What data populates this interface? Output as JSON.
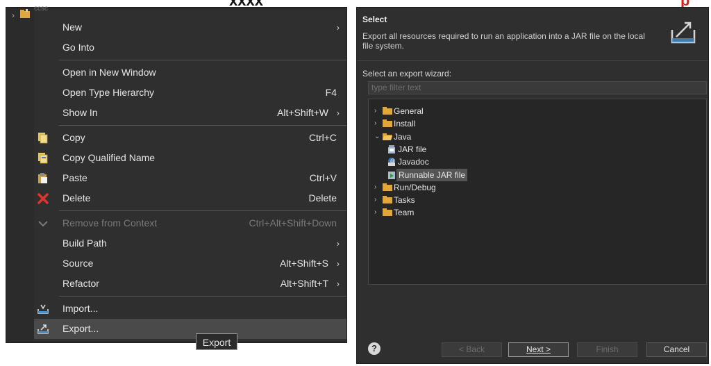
{
  "menu": {
    "project_label": "ccsc",
    "items": [
      {
        "label": "New",
        "accel": "",
        "submenu": true,
        "icon": ""
      },
      {
        "label": "Go Into",
        "accel": "",
        "submenu": false,
        "icon": ""
      },
      {
        "sep": true
      },
      {
        "label": "Open in New Window",
        "accel": "",
        "submenu": false,
        "icon": ""
      },
      {
        "label": "Open Type Hierarchy",
        "accel": "F4",
        "submenu": false,
        "icon": ""
      },
      {
        "label": "Show In",
        "accel": "Alt+Shift+W",
        "submenu": true,
        "icon": ""
      },
      {
        "sep": true
      },
      {
        "label": "Copy",
        "accel": "Ctrl+C",
        "submenu": false,
        "icon": "copy-icon"
      },
      {
        "label": "Copy Qualified Name",
        "accel": "",
        "submenu": false,
        "icon": "copy-qualified-icon"
      },
      {
        "label": "Paste",
        "accel": "Ctrl+V",
        "submenu": false,
        "icon": "paste-icon"
      },
      {
        "label": "Delete",
        "accel": "Delete",
        "submenu": false,
        "icon": "delete-icon"
      },
      {
        "sep": true
      },
      {
        "label": "Remove from Context",
        "accel": "Ctrl+Alt+Shift+Down",
        "submenu": false,
        "icon": "remove-context-icon",
        "disabled": true
      },
      {
        "label": "Build Path",
        "accel": "",
        "submenu": true,
        "icon": ""
      },
      {
        "label": "Source",
        "accel": "Alt+Shift+S",
        "submenu": true,
        "icon": ""
      },
      {
        "label": "Refactor",
        "accel": "Alt+Shift+T",
        "submenu": true,
        "icon": ""
      },
      {
        "sep": true
      },
      {
        "label": "Import...",
        "accel": "",
        "submenu": false,
        "icon": "import-icon"
      },
      {
        "label": "Export...",
        "accel": "",
        "submenu": false,
        "icon": "export-icon",
        "hover": true
      }
    ],
    "tooltip": "Export"
  },
  "wizard": {
    "title": "Select",
    "description": "Export all resources required to run an application into a JAR file on the local file system.",
    "select_label": "Select an export wizard:",
    "filter_placeholder": "type filter text",
    "tree": [
      {
        "label": "General",
        "level": 0,
        "expanded": false,
        "icon": "folder-icon"
      },
      {
        "label": "Install",
        "level": 0,
        "expanded": false,
        "icon": "folder-icon"
      },
      {
        "label": "Java",
        "level": 0,
        "expanded": true,
        "icon": "folder-open-icon"
      },
      {
        "label": "JAR file",
        "level": 1,
        "icon": "jar-icon"
      },
      {
        "label": "Javadoc",
        "level": 1,
        "icon": "javadoc-icon"
      },
      {
        "label": "Runnable JAR file",
        "level": 1,
        "icon": "runnable-jar-icon",
        "selected": true
      },
      {
        "label": "Run/Debug",
        "level": 0,
        "expanded": false,
        "icon": "folder-icon"
      },
      {
        "label": "Tasks",
        "level": 0,
        "expanded": false,
        "icon": "folder-icon"
      },
      {
        "label": "Team",
        "level": 0,
        "expanded": false,
        "icon": "folder-icon"
      }
    ],
    "buttons": {
      "back": "< Back",
      "next": "Next >",
      "finish": "Finish",
      "cancel": "Cancel"
    }
  }
}
